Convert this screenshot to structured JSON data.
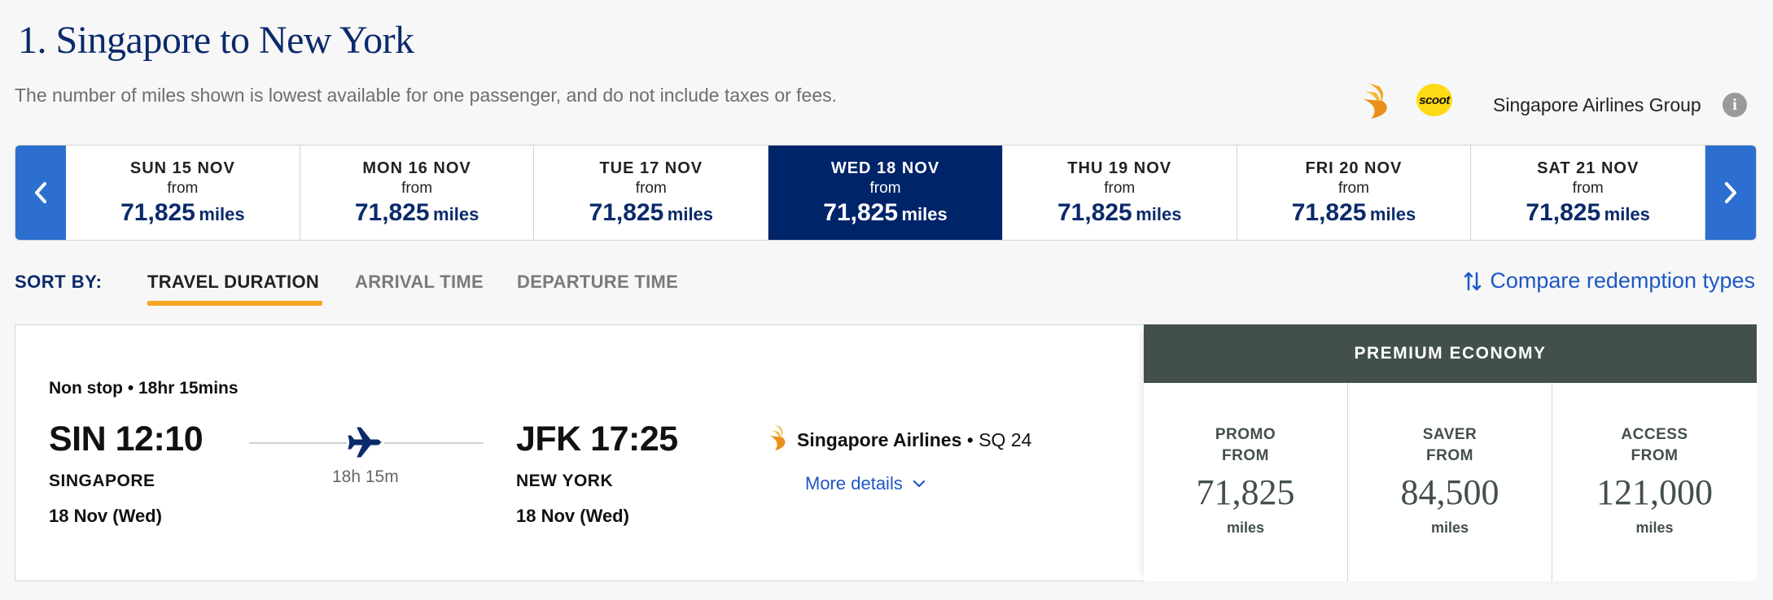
{
  "header": {
    "title": "1. Singapore to New York",
    "subtitle": "The number of miles shown is lowest available for one passenger, and do not include taxes or fees.",
    "scoot_logo_text": "scoot",
    "group_label": "Singapore Airlines Group",
    "info_icon": "i"
  },
  "date_strip": {
    "prev_icon": "chevron-left-icon",
    "next_icon": "chevron-right-icon",
    "dates": [
      {
        "label": "SUN 15 NOV",
        "from": "from",
        "miles": "71,825",
        "unit": "miles",
        "selected": false
      },
      {
        "label": "MON 16 NOV",
        "from": "from",
        "miles": "71,825",
        "unit": "miles",
        "selected": false
      },
      {
        "label": "TUE 17 NOV",
        "from": "from",
        "miles": "71,825",
        "unit": "miles",
        "selected": false
      },
      {
        "label": "WED 18 NOV",
        "from": "from",
        "miles": "71,825",
        "unit": "miles",
        "selected": true
      },
      {
        "label": "THU 19 NOV",
        "from": "from",
        "miles": "71,825",
        "unit": "miles",
        "selected": false
      },
      {
        "label": "FRI 20 NOV",
        "from": "from",
        "miles": "71,825",
        "unit": "miles",
        "selected": false
      },
      {
        "label": "SAT 21 NOV",
        "from": "from",
        "miles": "71,825",
        "unit": "miles",
        "selected": false
      }
    ]
  },
  "sort": {
    "label": "SORT BY:",
    "tabs": [
      {
        "label": "TRAVEL DURATION",
        "active": true
      },
      {
        "label": "ARRIVAL TIME",
        "active": false
      },
      {
        "label": "DEPARTURE TIME",
        "active": false
      }
    ],
    "compare_link": "Compare redemption types"
  },
  "flight": {
    "stops": "Non stop • 18hr 15mins",
    "departure": {
      "code_time": "SIN 12:10",
      "city": "SINGAPORE",
      "date": "18 Nov (Wed)"
    },
    "arrival": {
      "code_time": "JFK 17:25",
      "city": "NEW YORK",
      "date": "18 Nov (Wed)"
    },
    "duration": "18h 15m",
    "carrier": "Singapore Airlines",
    "flight_no": " • SQ 24",
    "more_details": "More details"
  },
  "fares": {
    "cabin": "PREMIUM ECONOMY",
    "columns": [
      {
        "name_line1": "PROMO",
        "name_line2": "FROM",
        "value": "71,825",
        "unit": "miles"
      },
      {
        "name_line1": "SAVER",
        "name_line2": "FROM",
        "value": "84,500",
        "unit": "miles"
      },
      {
        "name_line1": "ACCESS",
        "name_line2": "FROM",
        "value": "121,000",
        "unit": "miles"
      }
    ]
  },
  "colors": {
    "brand_navy": "#0b2a6b",
    "selected_date_bg": "#002469",
    "arrow_blue": "#2d6fd0",
    "tab_underline": "#f5a623",
    "link_blue": "#1d57c6",
    "fare_header_bg": "#434f4d"
  }
}
